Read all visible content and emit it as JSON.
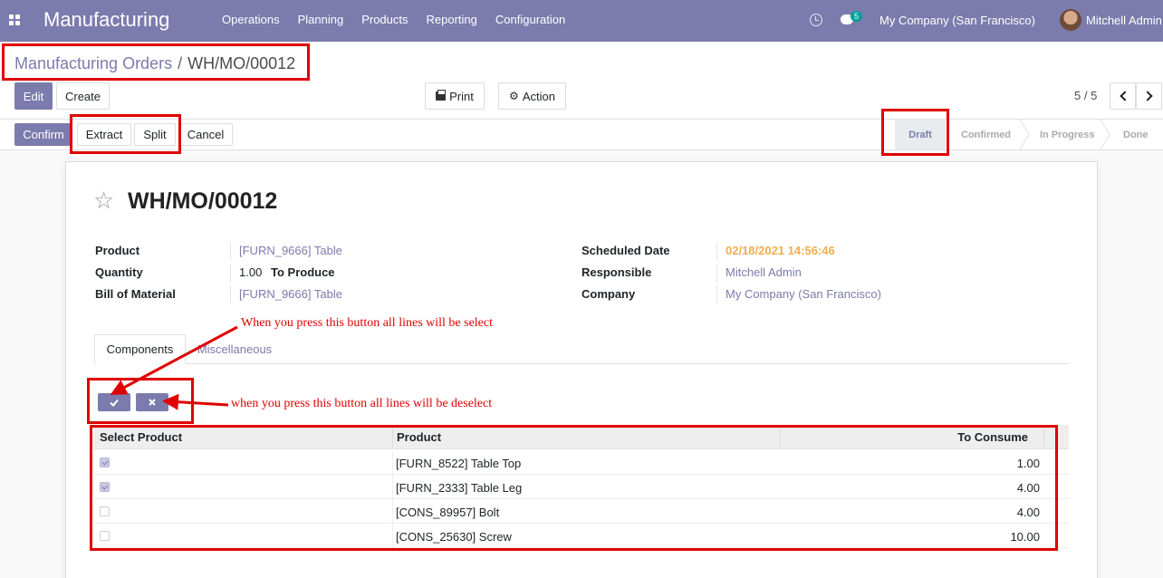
{
  "navbar": {
    "app_name": "Manufacturing",
    "menu": [
      "Operations",
      "Planning",
      "Products",
      "Reporting",
      "Configuration"
    ],
    "chat_count": "5",
    "company": "My Company (San Francisco)",
    "user": "Mitchell Admin"
  },
  "breadcrumb": {
    "parent": "Manufacturing Orders",
    "separator": "/",
    "current": "WH/MO/00012"
  },
  "toolbar": {
    "edit": "Edit",
    "create": "Create",
    "print": "Print",
    "action": "Action",
    "pager": "5 / 5"
  },
  "statusbar": {
    "buttons": {
      "confirm": "Confirm",
      "extract": "Extract",
      "split": "Split",
      "cancel": "Cancel"
    },
    "stages": [
      "Draft",
      "Confirmed",
      "In Progress",
      "Done"
    ],
    "active_stage": "Draft"
  },
  "record": {
    "title": "WH/MO/00012",
    "fields_left": [
      {
        "label": "Product",
        "value": "[FURN_9666] Table"
      },
      {
        "label": "Quantity",
        "value": "1.00",
        "suffix": "To Produce"
      },
      {
        "label": "Bill of Material",
        "value": "[FURN_9666] Table"
      }
    ],
    "fields_right": [
      {
        "label": "Scheduled Date",
        "value": "02/18/2021 14:56:46"
      },
      {
        "label": "Responsible",
        "value": "Mitchell Admin"
      },
      {
        "label": "Company",
        "value": "My Company (San Francisco)"
      }
    ]
  },
  "tabs": [
    "Components",
    "Miscellaneous"
  ],
  "components": {
    "select_all_icon": "check-icon",
    "deselect_all_icon": "times-icon",
    "columns": [
      "Select Product",
      "Product",
      "To Consume"
    ],
    "rows": [
      {
        "selected": true,
        "product": "[FURN_8522] Table Top",
        "to_consume": "1.00"
      },
      {
        "selected": true,
        "product": "[FURN_2333] Table Leg",
        "to_consume": "4.00"
      },
      {
        "selected": false,
        "product": "[CONS_89957] Bolt",
        "to_consume": "4.00"
      },
      {
        "selected": false,
        "product": "[CONS_25630] Screw",
        "to_consume": "10.00"
      }
    ]
  },
  "annotations": {
    "select_note": "When you press this button all lines will be select",
    "deselect_note": "when you press this button all lines will be deselect"
  },
  "colors": {
    "brand": "#7c7bad",
    "annotation": "#e00000",
    "date_warning": "#f0ad4e"
  }
}
